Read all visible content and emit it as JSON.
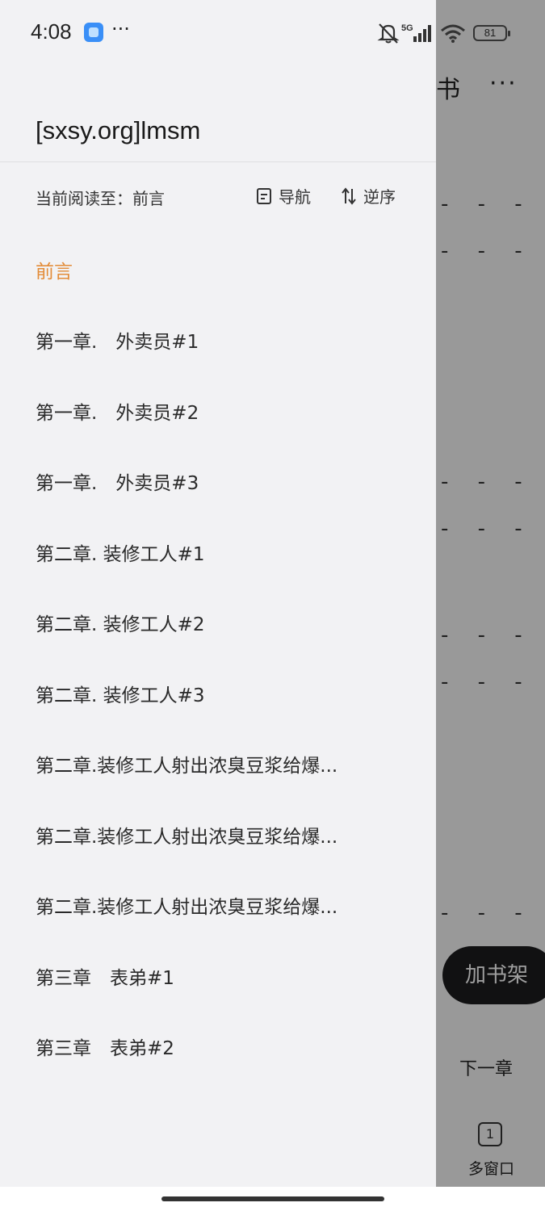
{
  "status_bar": {
    "time": "4:08",
    "more": "···",
    "network": "5G",
    "battery": "81"
  },
  "reader": {
    "title_fragment": "书",
    "more": "···",
    "dashes": "- - -",
    "add_to_shelf": "加书架",
    "next_chapter": "下一章",
    "window_count": "1",
    "multi_window": "多窗口"
  },
  "drawer": {
    "book_title": "[sxsy.org]lmsm",
    "reading_progress": "当前阅读至：前言",
    "nav_label": "导航",
    "reverse_label": "逆序",
    "accent_color": "#e38c38",
    "chapters": [
      {
        "label": "前言",
        "current": true
      },
      {
        "label": "第一章.　外卖员#1"
      },
      {
        "label": "第一章.　外卖员#2"
      },
      {
        "label": "第一章.　外卖员#3"
      },
      {
        "label": "第二章. 装修工人#1"
      },
      {
        "label": "第二章. 装修工人#2"
      },
      {
        "label": "第二章. 装修工人#3"
      },
      {
        "label": "第二章.装修工人射出浓臭豆浆给爆..."
      },
      {
        "label": "第二章.装修工人射出浓臭豆浆给爆..."
      },
      {
        "label": "第二章.装修工人射出浓臭豆浆给爆..."
      },
      {
        "label": "第三章　表弟#1"
      },
      {
        "label": "第三章　表弟#2"
      }
    ]
  }
}
